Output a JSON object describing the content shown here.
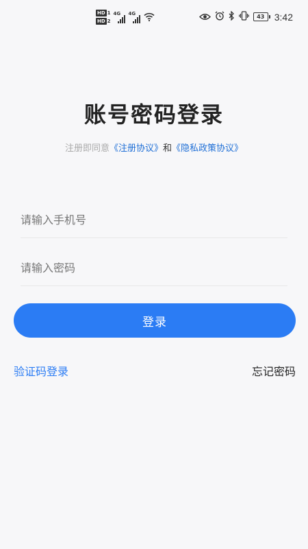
{
  "status_bar": {
    "hd_badge_1": "HD",
    "hd_num_1": "1",
    "hd_badge_2": "HD",
    "hd_num_2": "2",
    "network_1": "4G",
    "network_2": "4G",
    "battery_level": "43",
    "time": "3:42"
  },
  "header": {
    "title": "账号密码登录",
    "agreement_prefix": "注册即同意",
    "terms_link": "《注册协议》",
    "agreement_conjunction": "和",
    "privacy_link": "《隐私政策协议》"
  },
  "form": {
    "phone_placeholder": "请输入手机号",
    "phone_value": "",
    "password_placeholder": "请输入密码",
    "password_value": "",
    "login_label": "登录"
  },
  "footer": {
    "sms_login_label": "验证码登录",
    "forgot_password_label": "忘记密码"
  },
  "colors": {
    "accent": "#2b7cf4",
    "link": "#1f6fd6",
    "background": "#f7f7f9"
  }
}
